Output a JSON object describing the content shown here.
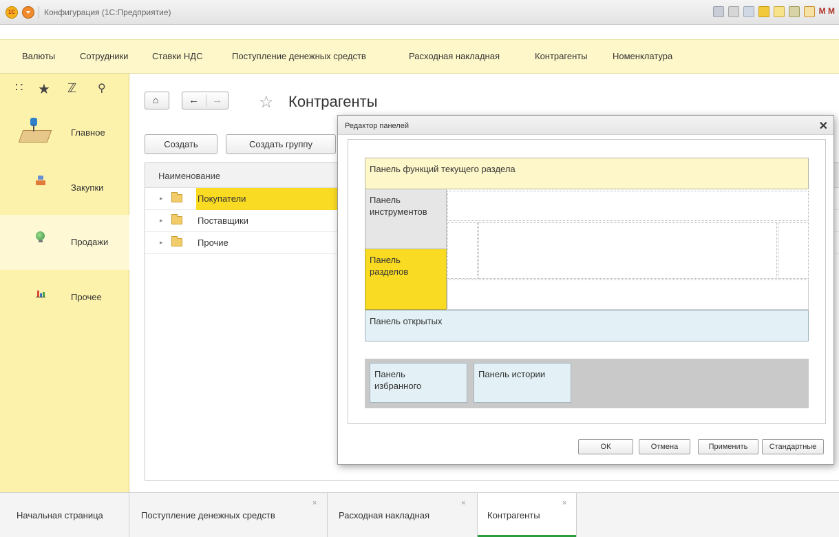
{
  "window": {
    "title": "Конфигурация (1С:Предприятие)",
    "toolbar_letters": "M M"
  },
  "topbar": {
    "items": [
      "Валюты",
      "Сотрудники",
      "Ставки НДС",
      "Поступление денежных средств",
      "Расходная накладная",
      "Контрагенты",
      "Номенклатура"
    ]
  },
  "sidebar": {
    "items": [
      {
        "label": "Главное",
        "icon": "desk-lamp-icon"
      },
      {
        "label": "Закупки",
        "icon": "purchases-icon"
      },
      {
        "label": "Продажи",
        "icon": "globe-icon"
      },
      {
        "label": "Прочее",
        "icon": "bar-chart-icon"
      }
    ],
    "active_index": 2
  },
  "form": {
    "title": "Контрагенты",
    "create_label": "Создать",
    "create_group_label": "Создать группу",
    "column_header": "Наименование",
    "rows": [
      "Покупатели",
      "Поставщики",
      "Прочие"
    ],
    "selected_row": 0
  },
  "dialog": {
    "title": "Редактор панелей",
    "panels": {
      "functions": "Панель функций текущего раздела",
      "tools": "Панель инструментов",
      "sections": "Панель разделов",
      "open": "Панель открытых",
      "favorites": "Панель избранного",
      "history": "Панель истории"
    },
    "buttons": {
      "ok": "ОК",
      "cancel": "Отмена",
      "apply": "Применить",
      "standard": "Стандартные"
    }
  },
  "tabs": [
    {
      "label": "Начальная страница",
      "closable": false
    },
    {
      "label": "Поступление денежных средств",
      "closable": true
    },
    {
      "label": "Расходная накладная",
      "closable": true
    },
    {
      "label": "Контрагенты",
      "closable": true
    }
  ],
  "active_tab": 3,
  "close_glyph": "×",
  "colors": {
    "accent_yellow": "#fadb23",
    "panel_yellow": "#fdf2ab",
    "panel_blue": "#e3f0f5",
    "active_tab_line": "#2c9b3c"
  }
}
